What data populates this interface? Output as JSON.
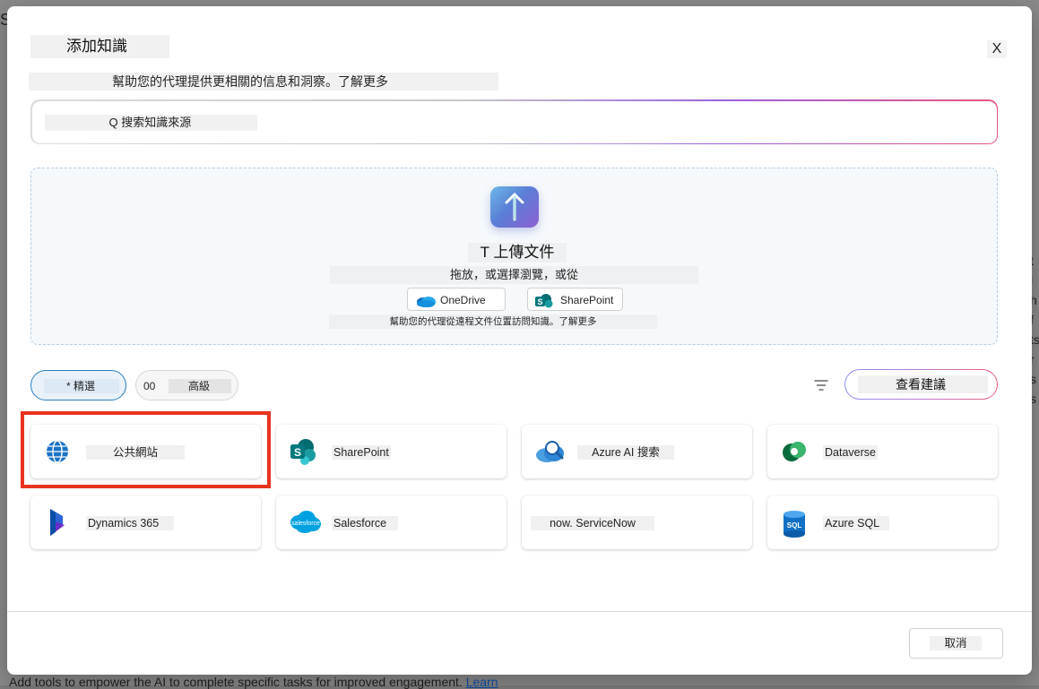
{
  "background": {
    "left_char": "S",
    "right_chars": [
      "t",
      "l",
      "h",
      "f",
      "ts",
      "r",
      "",
      "s",
      "s"
    ],
    "bottom_text": "Add tools to empower the AI to complete specific tasks for improved engagement.",
    "bottom_link": "Learn"
  },
  "dialog": {
    "title": "添加知識",
    "close_label": "X",
    "subtitle": "幫助您的代理提供更相關的信息和洞察。了解更多",
    "search": {
      "placeholder": "Q 搜索知識來源"
    },
    "upload": {
      "title": "T 上傳文件",
      "description": "拖放，或選擇瀏覽，或從",
      "onedrive_label": "OneDrive",
      "sharepoint_label": "SharePoint",
      "help_text": "幫助您的代理從遠程文件位置訪問知識。了解更多"
    },
    "filters": {
      "featured_label": "* 精選",
      "advanced_prefix": "00",
      "advanced_label": "高級"
    },
    "suggest_label": "查看建議",
    "sources": [
      {
        "label": "公共網站",
        "icon": "globe-icon"
      },
      {
        "label": "SharePoint",
        "icon": "sharepoint-icon"
      },
      {
        "label": "Azure AI 搜索",
        "icon": "azure-ai-search-icon"
      },
      {
        "label": "Dataverse",
        "icon": "dataverse-icon"
      },
      {
        "label": "Dynamics 365",
        "icon": "dynamics365-icon"
      },
      {
        "label": "Salesforce",
        "icon": "salesforce-icon"
      },
      {
        "label": "now. ServiceNow",
        "icon": "servicenow-icon"
      },
      {
        "label": "Azure SQL",
        "icon": "azure-sql-icon"
      }
    ],
    "cancel_label": "取消",
    "colors": {
      "accent_blue": "#2b7dbd",
      "highlight_red": "#e8331f"
    }
  }
}
